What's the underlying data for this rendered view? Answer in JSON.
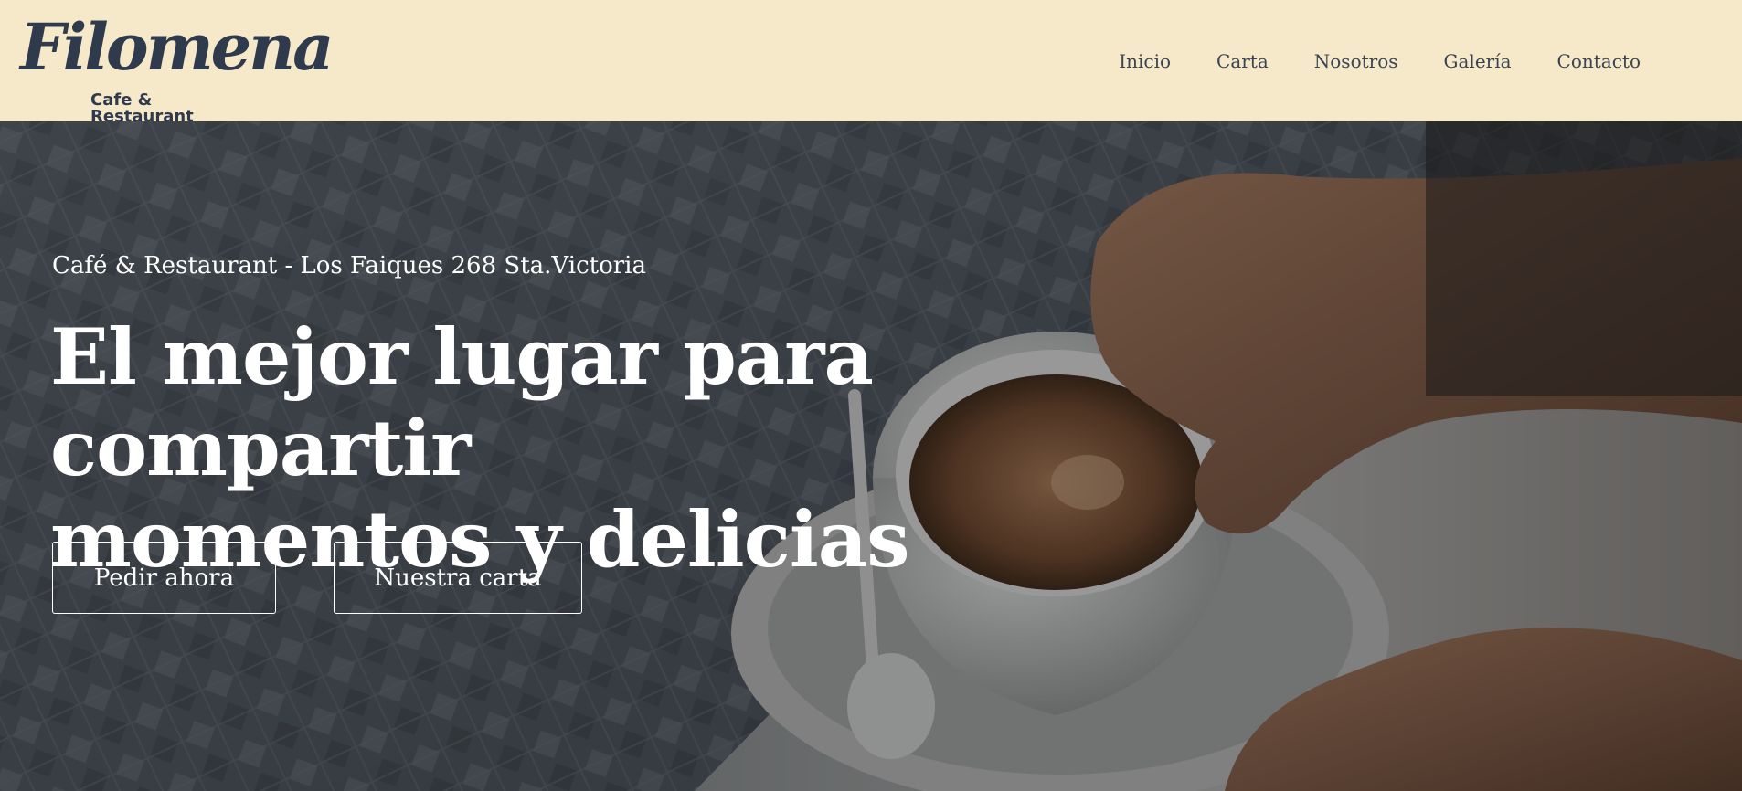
{
  "header": {
    "logo": {
      "script_text": "Filomena",
      "subtitle": "Cafe & Restaurant"
    },
    "nav": [
      {
        "label": "Inicio"
      },
      {
        "label": "Carta"
      },
      {
        "label": "Nosotros"
      },
      {
        "label": "Galería"
      },
      {
        "label": "Contacto"
      }
    ]
  },
  "hero": {
    "tagline": "Café & Restaurant - Los Faiques 268 Sta.Victoria",
    "title_line1": "El mejor lugar para compartir",
    "title_line2": "momentos y delicias",
    "buttons": {
      "order_label": "Pedir ahora",
      "menu_label": "Nuestra carta"
    },
    "background_image": "coffee-cup-photo"
  },
  "colors": {
    "header_bg": "#f5e9c9",
    "logo_color": "#2f3a4c",
    "nav_text": "#3c4352",
    "hero_text": "#ffffff"
  }
}
